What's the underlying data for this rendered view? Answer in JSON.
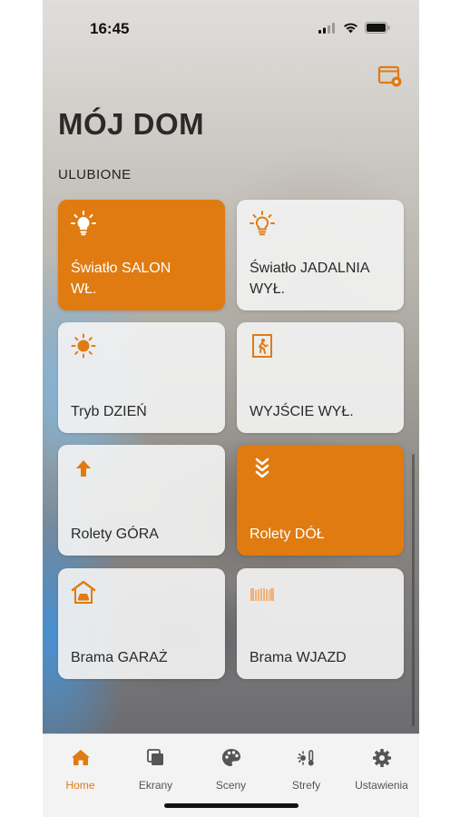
{
  "status_bar": {
    "time": "16:45"
  },
  "header": {
    "title": "MÓJ DOM",
    "section_label": "ULUBIONE"
  },
  "colors": {
    "accent": "#e07b12",
    "tile_bg": "#f2f2f2",
    "text_dark": "#2a2a2a"
  },
  "tiles": [
    {
      "label": "Światło SALON\nWŁ.",
      "icon": "lightbulb-on-icon",
      "active": true
    },
    {
      "label": "Światło JADALNIA\nWYŁ.",
      "icon": "lightbulb-off-icon",
      "active": false
    },
    {
      "label": "Tryb DZIEŃ",
      "icon": "sun-icon",
      "active": false
    },
    {
      "label": "WYJŚCIE WYŁ.",
      "icon": "exit-door-icon",
      "active": false
    },
    {
      "label": "Rolety GÓRA",
      "icon": "arrow-up-icon",
      "active": false
    },
    {
      "label": "Rolety DÓŁ",
      "icon": "chevrons-down-icon",
      "active": true
    },
    {
      "label": "Brama GARAŻ",
      "icon": "garage-icon",
      "active": false
    },
    {
      "label": "Brama WJAZD",
      "icon": "gate-icon",
      "active": false
    }
  ],
  "tabs": [
    {
      "label": "Home",
      "icon": "home-icon",
      "active": true
    },
    {
      "label": "Ekrany",
      "icon": "screens-icon",
      "active": false
    },
    {
      "label": "Sceny",
      "icon": "palette-icon",
      "active": false
    },
    {
      "label": "Strefy",
      "icon": "zones-icon",
      "active": false
    },
    {
      "label": "Ustawienia",
      "icon": "gear-icon",
      "active": false
    }
  ]
}
